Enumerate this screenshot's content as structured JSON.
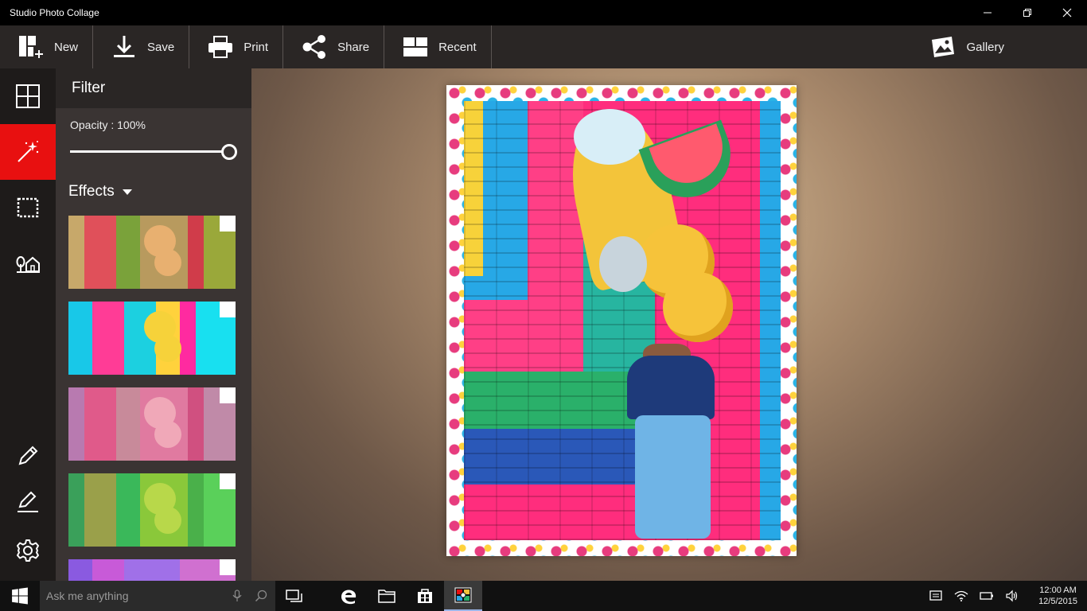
{
  "window": {
    "title": "Studio Photo Collage"
  },
  "toolbar": {
    "new_label": "New",
    "save_label": "Save",
    "print_label": "Print",
    "share_label": "Share",
    "recent_label": "Recent",
    "gallery_label": "Gallery"
  },
  "rail": {
    "items": [
      "layout-grid-icon",
      "magic-wand-icon",
      "crop-frame-icon",
      "landscape-icon",
      "pencil-icon",
      "draw-icon",
      "gear-icon"
    ],
    "active": "magic-wand-icon",
    "accent_color": "#e81010"
  },
  "filter_panel": {
    "title": "Filter",
    "opacity_label": "Opacity : 100%",
    "opacity_value": 1.0,
    "effects_label": "Effects",
    "effect_thumbnails": [
      {
        "tint": "sepia-green"
      },
      {
        "tint": "cyan-posterized"
      },
      {
        "tint": "rose"
      },
      {
        "tint": "green"
      },
      {
        "tint": "violet"
      }
    ]
  },
  "taskbar": {
    "search_placeholder": "Ask me anything",
    "time": "12:00 AM",
    "date": "12/5/2015"
  }
}
